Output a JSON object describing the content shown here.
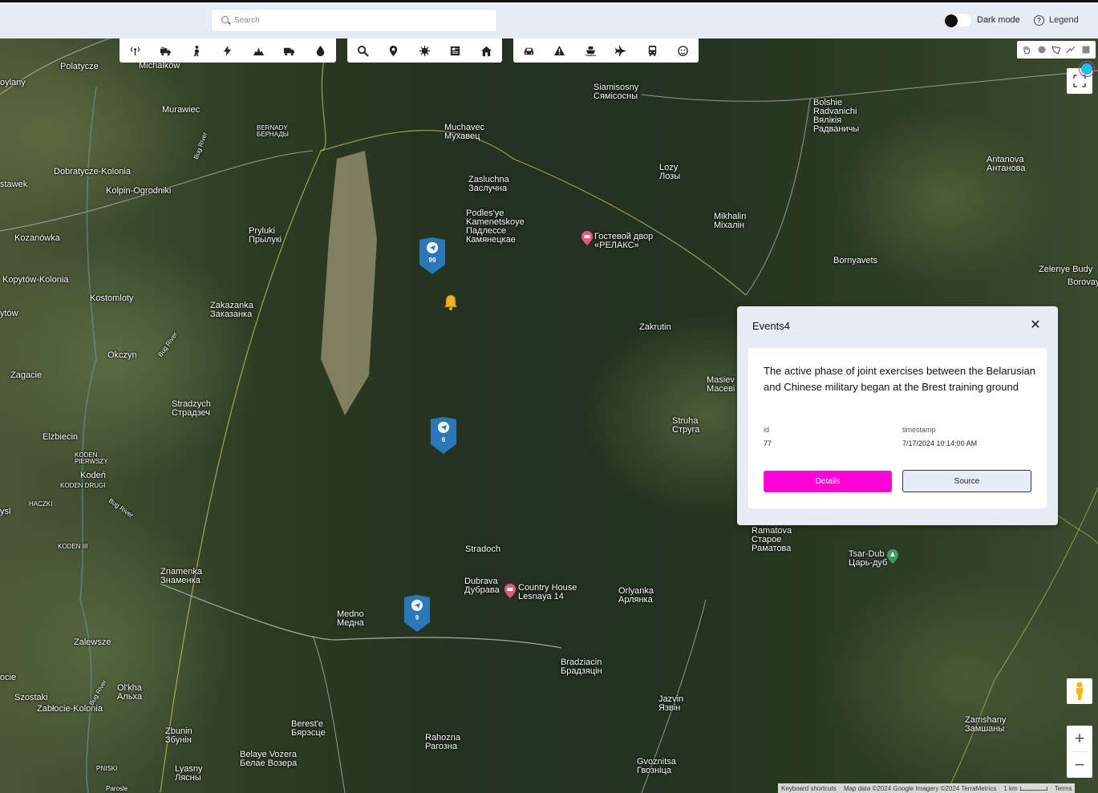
{
  "header": {
    "search_placeholder": "Search",
    "dark_mode_label": "Dark mode",
    "legend_label": "Legend"
  },
  "toolbar_groups": [
    {
      "icons": [
        "antenna-icon",
        "fire-truck-icon",
        "soldier-icon",
        "lightning-icon",
        "explosion-icon",
        "truck-icon",
        "water-drop-icon"
      ]
    },
    {
      "icons": [
        "zoom-search-icon",
        "location-pin-icon",
        "virus-icon",
        "newspaper-icon",
        "house-icon"
      ]
    },
    {
      "icons": [
        "car-icon",
        "warning-icon",
        "ship-icon",
        "airplane-icon",
        "bus-icon",
        "face-icon"
      ]
    }
  ],
  "draw_tools": [
    "hand-icon",
    "circle-icon",
    "polygon-icon",
    "polyline-icon",
    "rectangle-icon"
  ],
  "map": {
    "places": [
      {
        "text": "Polatycze"
      },
      {
        "text": "Michalkow"
      },
      {
        "text": "oylany"
      },
      {
        "text": "Murawiec"
      },
      {
        "text": "BERNADY\nБЕРНАДЫ"
      },
      {
        "text": "Muchavec\nМухавец"
      },
      {
        "text": "Siamisosny\nСямісосны"
      },
      {
        "text": "Bolshie\nRadvanichi\nВялікія\nРадваничы"
      },
      {
        "text": "Antanova\nАнтанова"
      },
      {
        "text": "Dobratycze-Kolonia"
      },
      {
        "text": "stawek"
      },
      {
        "text": "Kolpin-Ogrodniki"
      },
      {
        "text": "Zasluchna\nЗаслучна"
      },
      {
        "text": "Lozy\nЛозы"
      },
      {
        "text": "Podles'ye\nKamenetskoye\nПадлессе\nКамянецкае"
      },
      {
        "text": "Mikhalin\nМіхалін"
      },
      {
        "text": "Pryluki\nПрылукі"
      },
      {
        "text": "Kozanówka"
      },
      {
        "text": "Гостевой двор\n«РЕЛАКС»"
      },
      {
        "text": "Bornyavets"
      },
      {
        "text": "Zelenye Budy"
      },
      {
        "text": "Borovay"
      },
      {
        "text": "Kopytów-Kolonia"
      },
      {
        "text": "Kostomloty"
      },
      {
        "text": "Zakazanka\nЗаказанка"
      },
      {
        "text": "ytów"
      },
      {
        "text": "Zakrutin"
      },
      {
        "text": "Okczyn"
      },
      {
        "text": "Zagacie"
      },
      {
        "text": "Masiev\nМасеві"
      },
      {
        "text": "Stradzych\nСтрадзеч"
      },
      {
        "text": "Struha\nСтруга"
      },
      {
        "text": "Elzbiecin"
      },
      {
        "text": "KODEN\nPIERWSZY"
      },
      {
        "text": "Kodeń"
      },
      {
        "text": "KODEN DRUGI"
      },
      {
        "text": "HACZKI"
      },
      {
        "text": "ysl"
      },
      {
        "text": "Ramatova\nСтарое\nРаматова"
      },
      {
        "text": "Tsar-Dub\nЦарь-дуб"
      },
      {
        "text": "KODEN III"
      },
      {
        "text": "Stradoch"
      },
      {
        "text": "Znamenka\nЗнаменка"
      },
      {
        "text": "Dubrava\nДубрава"
      },
      {
        "text": "Country House\nLesnaya 14"
      },
      {
        "text": "Orlyanka\nАрлянка"
      },
      {
        "text": "Medno\nМедна"
      },
      {
        "text": "Zalewsze"
      },
      {
        "text": "Bradziacin\nБрадзяцін"
      },
      {
        "text": "ocie"
      },
      {
        "text": "Ol'kha\nАльха"
      },
      {
        "text": "Szostaki"
      },
      {
        "text": "Zabłocie-Kolonia"
      },
      {
        "text": "Jazvin\nЯзвін"
      },
      {
        "text": "Zamshany\nЗамшаны"
      },
      {
        "text": "Zbunin\nЗбунін"
      },
      {
        "text": "Berest'e\nБярэсце"
      },
      {
        "text": "Rahozna\nРагозна"
      },
      {
        "text": "Belaye Vozera\nБелае Возера"
      },
      {
        "text": "Lyasny\nЛясны"
      },
      {
        "text": "Gvoznitsa\nГвозніца"
      },
      {
        "text": "PNISKI"
      },
      {
        "text": "Parosle"
      },
      {
        "text": "Bug River"
      },
      {
        "text": "Bug River"
      },
      {
        "text": "Bug River"
      },
      {
        "text": "Bug River"
      }
    ],
    "clusters": [
      {
        "count": "99"
      },
      {
        "count": "6"
      },
      {
        "count": "9"
      }
    ],
    "attribution": {
      "shortcuts": "Keyboard shortcuts",
      "data": "Map data ©2024 Google Imagery ©2024 TerraMetrics",
      "scale": "1 km",
      "terms": "Terms"
    }
  },
  "popup": {
    "title": "Events4",
    "headline": "The active phase of joint exercises between the Belarusian and Chinese military began at the Brest training ground",
    "id_label": "id",
    "id_value": "77",
    "timestamp_label": "timestamp",
    "timestamp_value": "7/17/2024 10:14:00 AM",
    "details_label": "Details",
    "source_label": "Source"
  },
  "colors": {
    "accent": "#ff00d6",
    "marker": "#2a78b8",
    "panel": "#e8ecf7"
  }
}
